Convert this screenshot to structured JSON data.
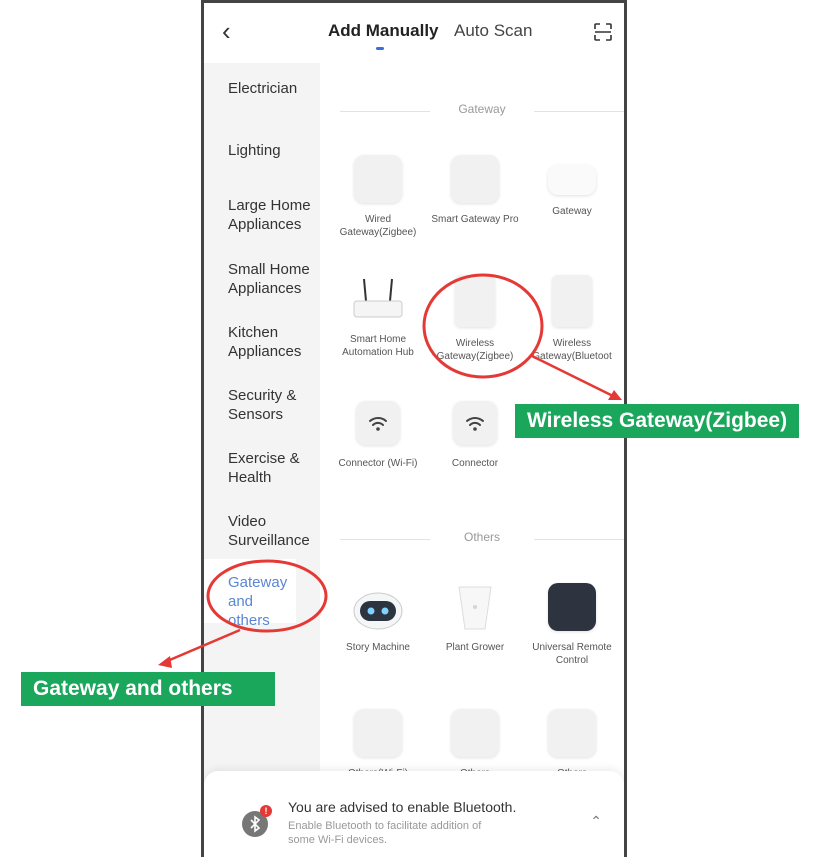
{
  "header": {
    "back_icon": "chevron-left-icon",
    "tabs": [
      {
        "label": "Add Manually",
        "active": true
      },
      {
        "label": "Auto Scan",
        "active": false
      }
    ],
    "scan_icon": "scan-icon",
    "accent_color": "#3a6fd8"
  },
  "sidebar": {
    "items": [
      {
        "label": "Electrician"
      },
      {
        "label": "Lighting"
      },
      {
        "label": "Large Home Appliances"
      },
      {
        "label": "Small Home Appliances"
      },
      {
        "label": "Kitchen Appliances"
      },
      {
        "label": "Security & Sensors"
      },
      {
        "label": "Exercise & Health"
      },
      {
        "label": "Video Surveillance"
      },
      {
        "label": "Gateway and others",
        "active": true
      }
    ],
    "active_color": "#5b86d4"
  },
  "sections": [
    {
      "title": "Gateway",
      "devices": [
        {
          "label": "Wired Gateway(Zigbee)"
        },
        {
          "label": "Smart Gateway Pro"
        },
        {
          "label": "Gateway"
        },
        {
          "label": "Smart Home Automation Hub"
        },
        {
          "label": "Wireless Gateway(Zigbee)"
        },
        {
          "label": "Wireless Gateway(Bluetoot"
        },
        {
          "label": "Connector (Wi-Fi)"
        },
        {
          "label": "Connector"
        }
      ]
    },
    {
      "title": "Others",
      "devices": [
        {
          "label": "Story Machine"
        },
        {
          "label": "Plant Grower"
        },
        {
          "label": "Universal Remote Control"
        },
        {
          "label": "Others(Wi-Fi)"
        },
        {
          "label": "Others"
        },
        {
          "label": "Others"
        }
      ]
    }
  ],
  "bluetooth_banner": {
    "title": "You are advised to enable Bluetooth.",
    "subtitle": "Enable Bluetooth to facilitate addition of some Wi-Fi devices.",
    "badge": "!",
    "icon": "bluetooth-icon",
    "collapse_icon": "chevron-up-icon"
  },
  "annotations": [
    {
      "label": "Wireless Gateway(Zigbee)",
      "color": "#1aa75c"
    },
    {
      "label": "Gateway and others",
      "color": "#1aa75c"
    }
  ],
  "annotation_circle_color": "#e53935"
}
